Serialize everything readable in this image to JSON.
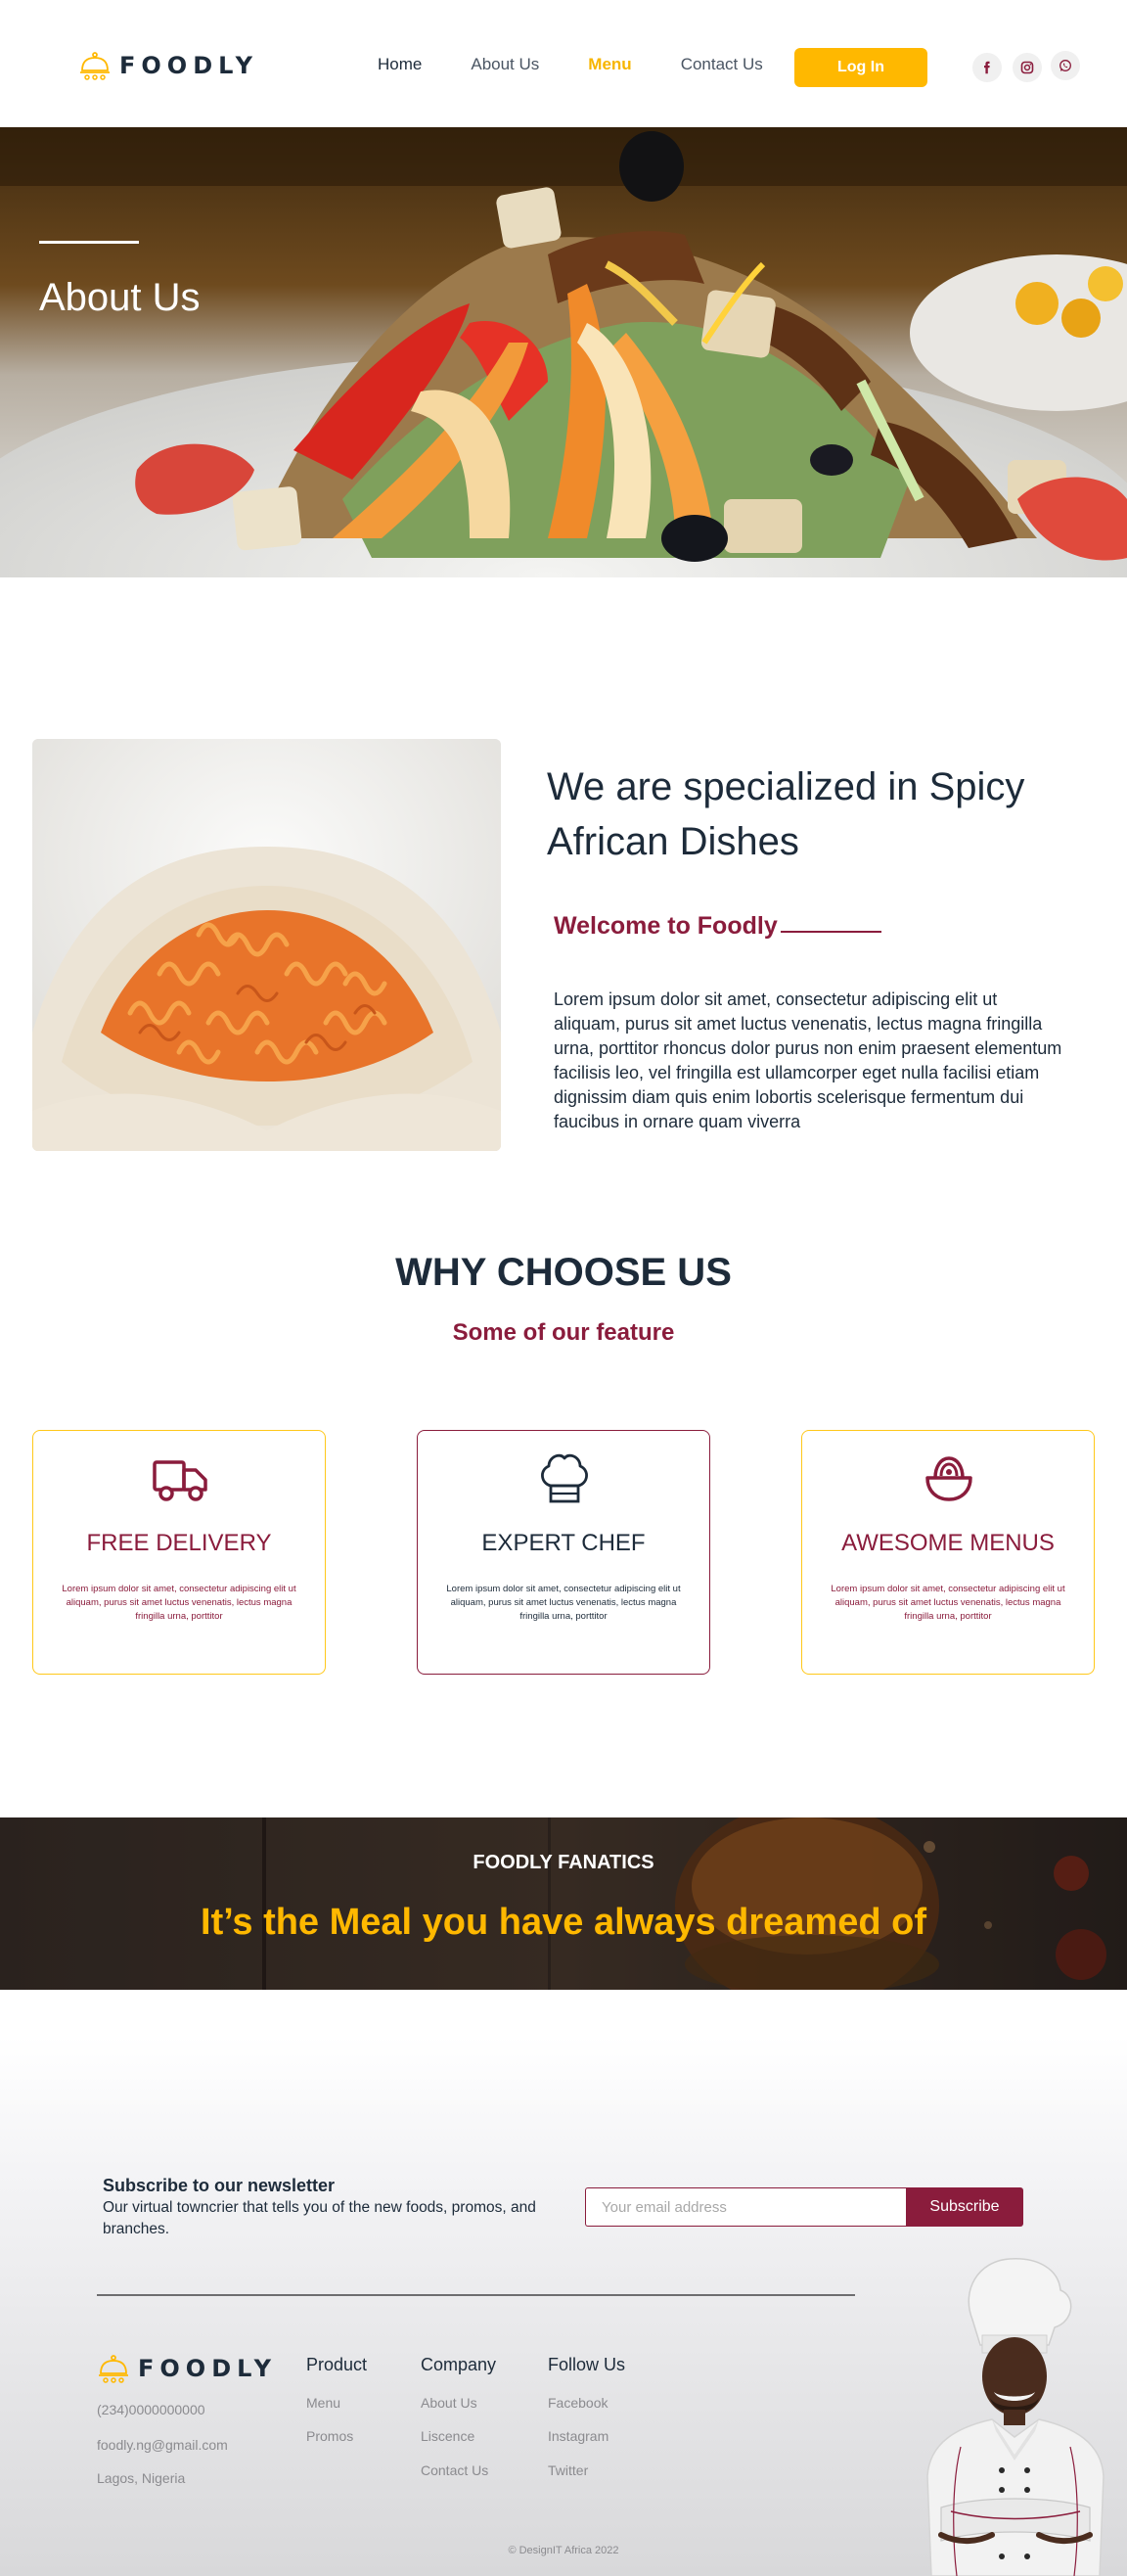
{
  "brand": {
    "name": "FOODLY"
  },
  "nav": {
    "links": [
      {
        "label": "Home"
      },
      {
        "label": "About Us"
      },
      {
        "label": "Menu"
      },
      {
        "label": "Contact Us"
      }
    ],
    "login_label": "Log In",
    "social": [
      {
        "icon": "facebook-icon"
      },
      {
        "icon": "instagram-icon"
      },
      {
        "icon": "whatsapp-icon"
      }
    ]
  },
  "hero": {
    "title": "About Us"
  },
  "about": {
    "title": "We are specialized in Spicy African Dishes",
    "welcome": "Welcome to Foodly",
    "text": "Lorem ipsum dolor sit amet, consectetur adipiscing elit ut aliquam, purus sit amet luctus venenatis, lectus magna fringilla urna, porttitor rhoncus dolor purus non enim praesent elementum facilisis leo, vel fringilla est ullamcorper eget nulla facilisi etiam dignissim diam quis enim lobortis scelerisque fermentum dui faucibus in ornare quam viverra"
  },
  "why": {
    "title": "WHY CHOOSE US",
    "subtitle": "Some of our feature",
    "cards": [
      {
        "title": "FREE DELIVERY",
        "text": "Lorem ipsum dolor sit amet, consectetur adipiscing elit ut aliquam, purus sit amet luctus venenatis, lectus magna fringilla urna, porttitor",
        "icon": "truck-icon"
      },
      {
        "title": "EXPERT CHEF",
        "text": "Lorem ipsum dolor sit amet, consectetur adipiscing elit ut aliquam, purus sit amet luctus venenatis, lectus magna fringilla urna, porttitor",
        "icon": "chef-hat-icon"
      },
      {
        "title": "AWESOME MENUS",
        "text": "Lorem ipsum dolor sit amet, consectetur adipiscing elit ut aliquam, purus sit amet luctus venenatis, lectus magna fringilla urna, porttitor",
        "icon": "food-bowl-icon"
      }
    ]
  },
  "banner": {
    "small": "FOODLY FANATICS",
    "big": "It’s the Meal you have always dreamed of"
  },
  "newsletter": {
    "title": "Subscribe to our newsletter",
    "text": "Our virtual towncrier that tells you of the new foods, promos, and branches.",
    "placeholder": "Your email address",
    "button": "Subscribe"
  },
  "footer": {
    "phone": "(234)0000000000",
    "email": "foodly.ng@gmail.com",
    "location": "Lagos, Nigeria",
    "columns": [
      {
        "title": "Product",
        "links": [
          "Menu",
          "Promos"
        ]
      },
      {
        "title": "Company",
        "links": [
          "About Us",
          "Liscence",
          "Contact Us"
        ]
      },
      {
        "title": "Follow Us",
        "links": [
          "Facebook",
          "Instagram",
          "Twitter"
        ]
      }
    ],
    "copyright": "© DesignIT Africa 2022"
  },
  "colors": {
    "accent_yellow": "#ffb800",
    "maroon": "#8a1c3c",
    "navy": "#1d2b3a"
  }
}
